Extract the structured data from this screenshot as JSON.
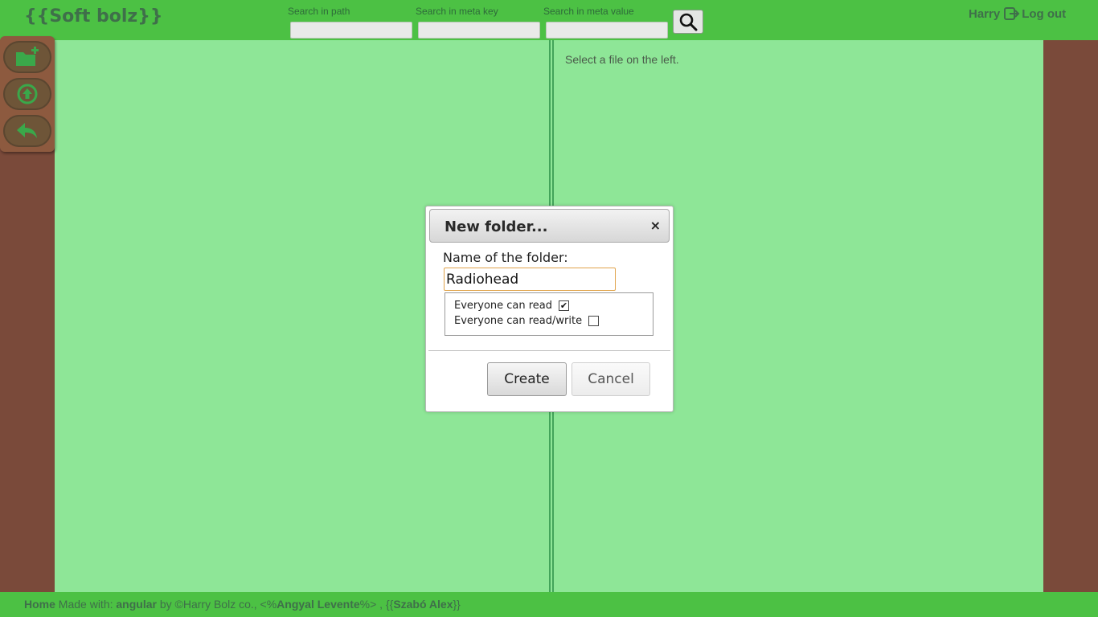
{
  "header": {
    "logo": "{{Soft bolz}}",
    "search_path_label": "Search in path",
    "search_meta_key_label": "Search in meta key",
    "search_meta_value_label": "Search in meta value",
    "search_path_value": "",
    "search_meta_key_value": "",
    "search_meta_value_value": "",
    "search_icon": "search-icon",
    "username": "Harry",
    "logout_label": "Log out",
    "logout_icon": "logout-icon"
  },
  "toolbar": {
    "items": [
      {
        "icon": "new-folder-icon"
      },
      {
        "icon": "upload-icon"
      },
      {
        "icon": "back-icon"
      }
    ]
  },
  "main": {
    "right_hint": "Select a file on the left."
  },
  "modal": {
    "title": "New folder...",
    "close_label": "×",
    "name_label": "Name of the folder:",
    "name_value": "Radiohead",
    "perm_read_label": "Everyone can read",
    "perm_read_checked": true,
    "perm_readwrite_label": "Everyone can read/write",
    "perm_readwrite_checked": false,
    "create_label": "Create",
    "cancel_label": "Cancel"
  },
  "footer": {
    "home": "Home",
    "made_with": "Made with: ",
    "framework": "angular",
    "by": " by ©Harry Bolz co., <%",
    "author1": "Angyal Levente",
    "sep": "%> , {{",
    "author2": "Szabó Alex",
    "end": "}}"
  },
  "colors": {
    "header_green": "#4cc144",
    "panel_green": "#8ee697",
    "sidebar_brown": "#7a4a3a",
    "accent_text": "#3f6f4a"
  }
}
